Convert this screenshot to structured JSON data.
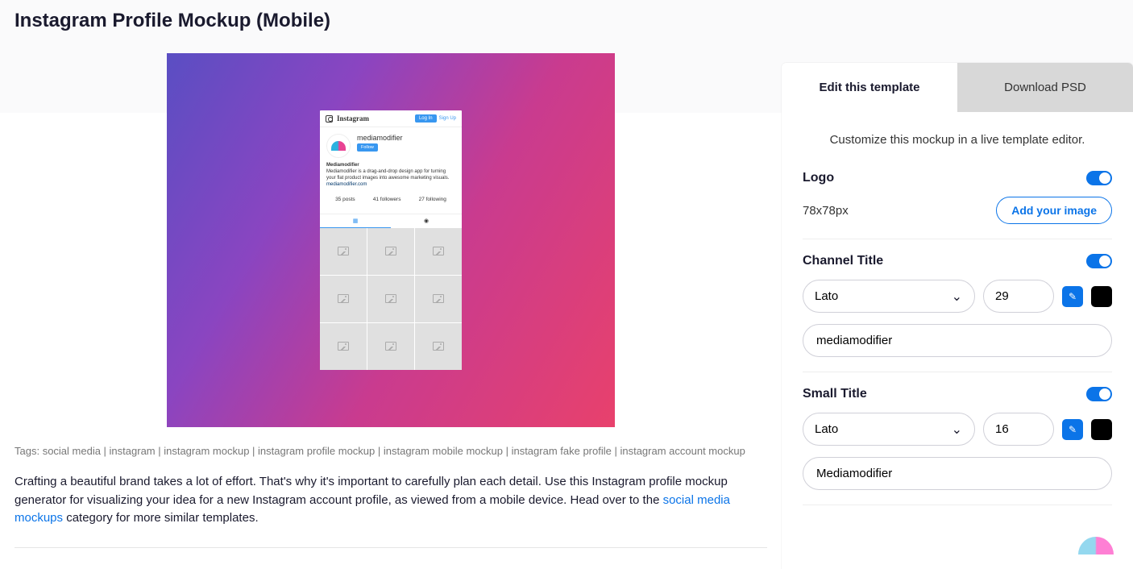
{
  "page": {
    "title": "Instagram Profile Mockup (Mobile)",
    "tags_prefix": "Tags: ",
    "tags": "social media | instagram | instagram mockup | instagram profile mockup | instagram mobile mockup | instagram fake profile | instagram account mockup",
    "description_pre": "Crafting a beautiful brand takes a lot of effort. That's why it's important to carefully plan each detail. Use this Instagram profile mockup generator for visualizing your idea for a new Instagram account profile, as viewed from a mobile device. Head over to the ",
    "description_link": "social media mockups",
    "description_post": " category for more similar templates."
  },
  "preview": {
    "brand": "Instagram",
    "login": "Log In",
    "signup": "Sign Up",
    "username": "mediamodifier",
    "follow": "Follow",
    "bio_title": "Mediamodifier",
    "bio_text": "Mediamodifier is a drag-and-drop design app for turning your flat product images into awesome marketing visuals.",
    "bio_link": "mediamodifier.com",
    "stats": {
      "posts": "35 posts",
      "followers": "41 followers",
      "following": "27 following"
    }
  },
  "sidebar": {
    "tabs": {
      "edit": "Edit this template",
      "download": "Download PSD"
    },
    "subtitle": "Customize this mockup in a live template editor.",
    "logo": {
      "label": "Logo",
      "size": "78x78px",
      "button": "Add your image"
    },
    "channel_title": {
      "label": "Channel Title",
      "font": "Lato",
      "size": "29",
      "value": "mediamodifier"
    },
    "small_title": {
      "label": "Small Title",
      "font": "Lato",
      "size": "16",
      "value": "Mediamodifier"
    }
  }
}
